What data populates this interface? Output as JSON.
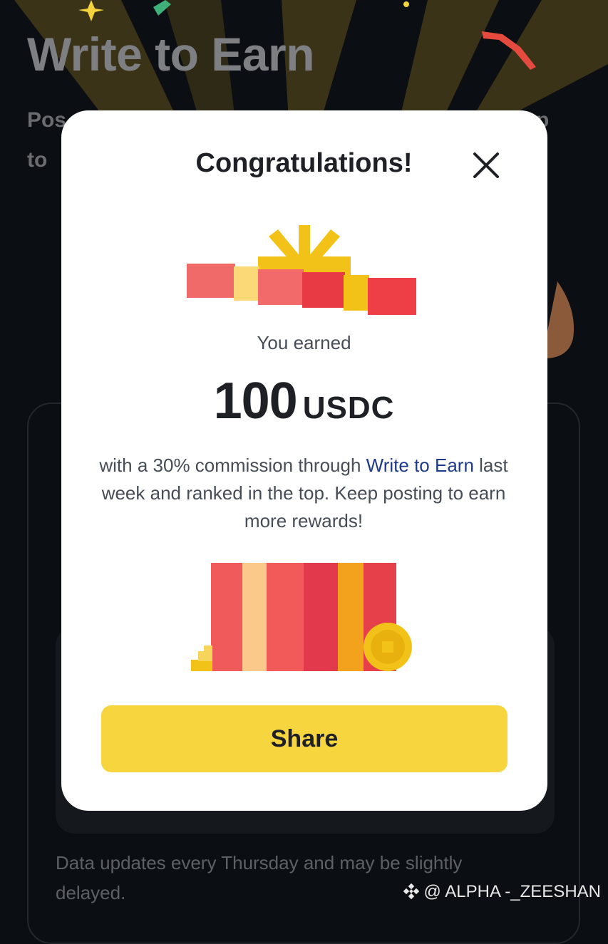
{
  "background": {
    "title": "Write to Earn",
    "subtitle_fragment_1": "Pos",
    "subtitle_fragment_2": "to",
    "subtitle_right_fragment": "p",
    "footnote": "Data updates every Thursday and may be slightly delayed."
  },
  "modal": {
    "title": "Congratulations!",
    "earned_label": "You earned",
    "amount_value": "100",
    "amount_unit": "USDC",
    "description_part1": "with a 30% commission through ",
    "description_link": "Write to Earn",
    "description_part2": " last week and ranked in the top. Keep posting to earn more rewards!",
    "share_label": "Share",
    "close_icon": "close-icon"
  },
  "watermark": "@ ALPHA -_ZEESHAN",
  "colors": {
    "primary_button": "#f7d53f",
    "background": "#0b0e12",
    "modal_background": "#ffffff",
    "text_primary": "#1e2026",
    "link": "#1e3a8a"
  }
}
